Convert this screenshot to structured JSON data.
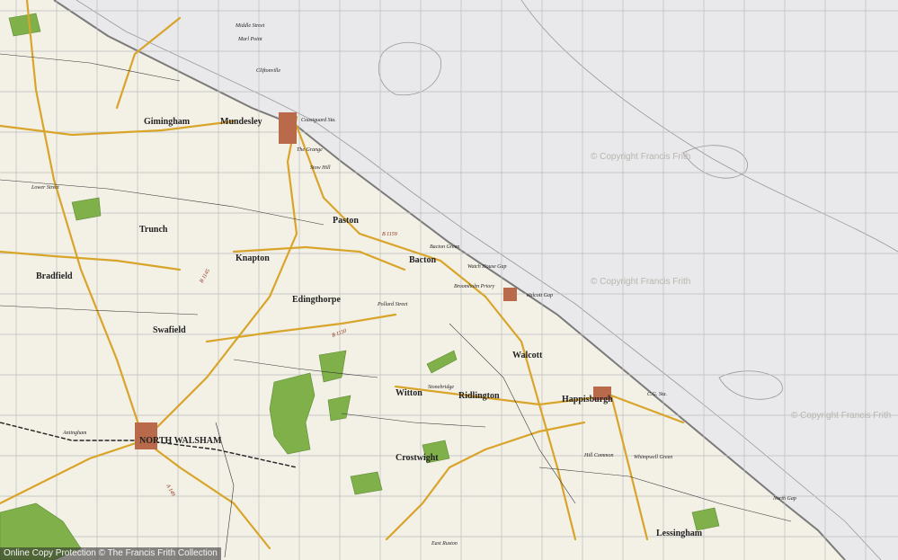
{
  "map": {
    "watermark": "© Copyright Francis Frith",
    "footer": "Online Copy Protection  © The Francis Frith Collection",
    "colors": {
      "land": "#f3f0e6",
      "sea": "#e9e8ea",
      "woods": "#7fb04a",
      "roads": "#d8a52a",
      "grid": "#bdbdbd"
    },
    "places": [
      {
        "id": "mundesley",
        "name": "Mundesley",
        "size": "big"
      },
      {
        "id": "gimingham",
        "name": "Gimingham",
        "size": "big"
      },
      {
        "id": "paston",
        "name": "Paston",
        "size": "big"
      },
      {
        "id": "knapton",
        "name": "Knapton",
        "size": "big"
      },
      {
        "id": "trunch",
        "name": "Trunch",
        "size": "big"
      },
      {
        "id": "bacton",
        "name": "Bacton",
        "size": "big"
      },
      {
        "id": "edingthorpe",
        "name": "Edingthorpe",
        "size": "big"
      },
      {
        "id": "swafield",
        "name": "Swafield",
        "size": "big"
      },
      {
        "id": "bradfield",
        "name": "Bradfield",
        "size": "big"
      },
      {
        "id": "witton",
        "name": "Witton",
        "size": "big"
      },
      {
        "id": "ridlington",
        "name": "Ridlington",
        "size": "big"
      },
      {
        "id": "walcott",
        "name": "Walcott",
        "size": "big"
      },
      {
        "id": "happisburgh",
        "name": "Happisburgh",
        "size": "big"
      },
      {
        "id": "crostwight",
        "name": "Crostwight",
        "size": "big"
      },
      {
        "id": "north_walsham",
        "name": "NORTH WALSHAM",
        "size": "big"
      },
      {
        "id": "lessingham",
        "name": "Lessingham",
        "size": "big"
      },
      {
        "id": "antingham",
        "name": "Antingham",
        "size": "sm"
      },
      {
        "id": "middle_street",
        "name": "Middle Street",
        "size": "sm"
      },
      {
        "id": "marl_point",
        "name": "Marl Point",
        "size": "sm"
      },
      {
        "id": "cliftonville",
        "name": "Cliftonville",
        "size": "sm"
      },
      {
        "id": "coastguard",
        "name": "Coastguard Sta.",
        "size": "sm"
      },
      {
        "id": "the_grange",
        "name": "The Grange",
        "size": "sm"
      },
      {
        "id": "stow_hill",
        "name": "Stow Hill",
        "size": "sm"
      },
      {
        "id": "bacton_green",
        "name": "Bacton Green",
        "size": "sm"
      },
      {
        "id": "watch_house_gap",
        "name": "Watch House Gap",
        "size": "sm"
      },
      {
        "id": "walcott_gap",
        "name": "Walcott Gap",
        "size": "sm"
      },
      {
        "id": "broomholm",
        "name": "Broomholm Priory",
        "size": "sm"
      },
      {
        "id": "pollard_street",
        "name": "Pollard Street",
        "size": "sm"
      },
      {
        "id": "stonebridge",
        "name": "Stonebridge",
        "size": "sm"
      },
      {
        "id": "lower_street",
        "name": "Lower Street",
        "size": "sm"
      },
      {
        "id": "hill_common",
        "name": "Hill Common",
        "size": "sm"
      },
      {
        "id": "cg_sta",
        "name": "C.G. Sta.",
        "size": "sm"
      },
      {
        "id": "whimpwell",
        "name": "Whimpwell Green",
        "size": "sm"
      },
      {
        "id": "east_ruston",
        "name": "East Ruston",
        "size": "sm"
      },
      {
        "id": "north_gap",
        "name": "North Gap",
        "size": "sm"
      }
    ],
    "roads": [
      "B 1145",
      "B 1159",
      "B 1150",
      "A 149"
    ]
  }
}
